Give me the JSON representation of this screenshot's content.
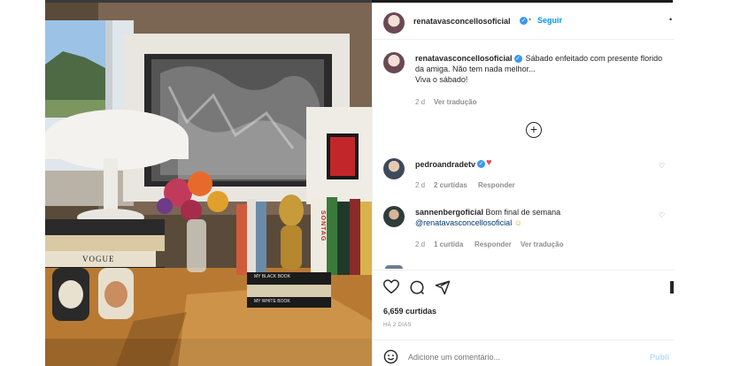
{
  "header": {
    "username": "renatavasconcellosoficial",
    "follow_label": "Seguir",
    "more_label": "•"
  },
  "caption": {
    "username": "renatavasconcellosoficial",
    "text": "Sábado enfeitado com presente florido da amiga. Não tem nada melhor...",
    "text2": "Viva o sábado!",
    "time": "2 d",
    "translate_label": "Ver tradução"
  },
  "load_more_label": "+",
  "comments": [
    {
      "username": "pedroandradetv",
      "text": "",
      "time": "2 d",
      "likes": "2 curtidas",
      "reply_label": "Responder"
    },
    {
      "username": "sannenbergoficial",
      "text": "Bom final de semana",
      "mention": "@renatavasconcellosoficial",
      "time": "2 d",
      "likes": "1 curtida",
      "reply_label": "Responder",
      "translate_label": "Ver tradução"
    }
  ],
  "actions": {
    "likes_count": "6,659 curtidas",
    "date": "HÁ 2 DIAS"
  },
  "comment_box": {
    "placeholder": "Adicione um comentário...",
    "publish_label": "Publi"
  },
  "photo": {
    "book_spine_1": "SONTAG",
    "book_title_1": "MY BLACK BOOK",
    "book_title_2": "MY WHITE BOOK",
    "book_vogue": "VOGUE"
  },
  "colors": {
    "verified": "#3897f0",
    "link": "#0095f6",
    "heart": "#ed4956"
  }
}
